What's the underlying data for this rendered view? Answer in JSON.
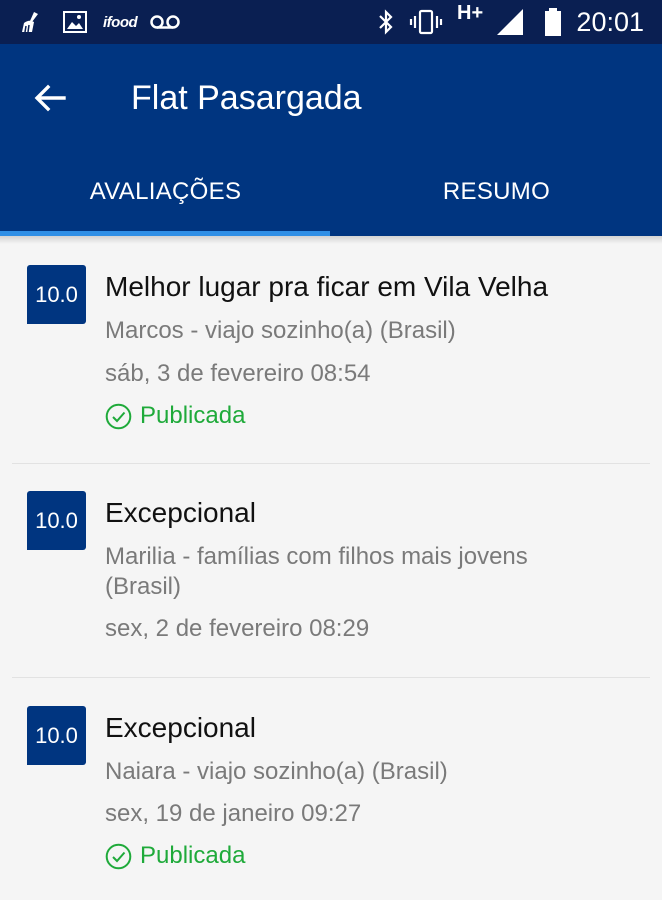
{
  "status_bar": {
    "ifood_text": "ifood",
    "network_label": "H+",
    "time": "20:01"
  },
  "app_bar": {
    "title": "Flat Pasargada",
    "tabs": [
      {
        "label": "AVALIAÇÕES",
        "active": true
      },
      {
        "label": "RESUMO",
        "active": false
      }
    ]
  },
  "icons": {
    "back": "arrow-left-icon",
    "status": "check-circle-icon"
  },
  "colors": {
    "brand_blue": "#003580",
    "status_bar": "#0a1f52",
    "tab_indicator": "#2f8fe6",
    "published_green": "#1faa3a"
  },
  "reviews": [
    {
      "score": "10.0",
      "title": "Melhor lugar pra ficar em Vila Velha",
      "author": "Marcos - viajo sozinho(a) (Brasil)",
      "date": "sáb, 3 de fevereiro 08:54",
      "status": "Publicada"
    },
    {
      "score": "10.0",
      "title": "Excepcional",
      "author": "Marilia - famílias com filhos mais jovens (Brasil)",
      "date": "sex, 2 de fevereiro 08:29",
      "status": ""
    },
    {
      "score": "10.0",
      "title": "Excepcional",
      "author": "Naiara - viajo sozinho(a) (Brasil)",
      "date": "sex, 19 de janeiro 09:27",
      "status": "Publicada"
    }
  ]
}
